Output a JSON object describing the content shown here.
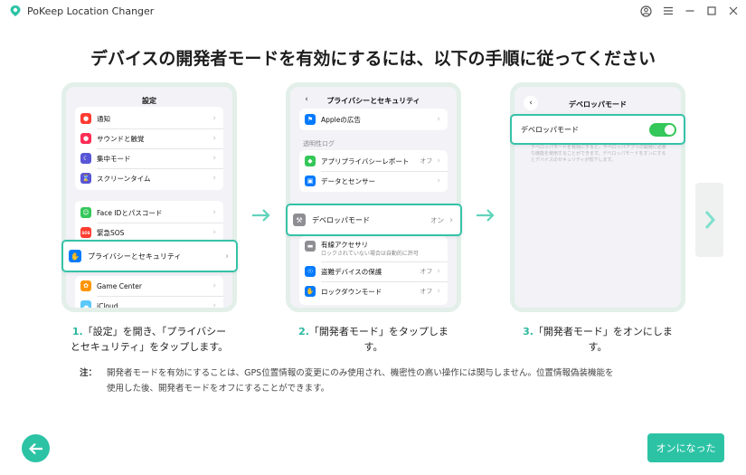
{
  "app": {
    "title": "PoKeep Location Changer"
  },
  "headline": "デバイスの開発者モードを有効にするには、以下の手順に従ってください",
  "phone1": {
    "title": "設定",
    "group1": [
      {
        "label": "通知",
        "color": "#ff3b30",
        "icon": "bell-icon"
      },
      {
        "label": "サウンドと触覚",
        "color": "#ff2d55",
        "icon": "speaker-icon"
      },
      {
        "label": "集中モード",
        "color": "#5856d6",
        "icon": "moon-icon"
      },
      {
        "label": "スクリーンタイム",
        "color": "#5856d6",
        "icon": "hourglass-icon"
      }
    ],
    "group2": [
      {
        "label": "Face IDとパスコード",
        "color": "#34c759",
        "icon": "face-id-icon"
      },
      {
        "label": "緊急SOS",
        "color": "#ff3b30",
        "icon": "sos-icon",
        "glyph": "SOS"
      }
    ],
    "highlight": {
      "label": "プライバシーとセキュリティ",
      "color": "#007aff",
      "icon": "hand-icon"
    },
    "group3": [
      {
        "label": "Game Center",
        "color": "#ff9500",
        "icon": "game-center-icon"
      },
      {
        "label": "iCloud",
        "color": "#5ac8fa",
        "icon": "cloud-icon"
      }
    ]
  },
  "phone2": {
    "title": "プライバシーとセキュリティ",
    "top_item": {
      "label": "Appleの広告",
      "color": "#007aff",
      "icon": "megaphone-icon"
    },
    "section_label": "透明性ログ",
    "group1": [
      {
        "label": "アプリプライバシーレポート",
        "value": "オフ",
        "color": "#34c759",
        "icon": "shield-icon"
      },
      {
        "label": "データとセンサー",
        "color": "#007aff",
        "icon": "cube-icon"
      }
    ],
    "highlight": {
      "label": "デベロッパモード",
      "value": "オン",
      "color": "#8e8e93",
      "icon": "hammer-icon"
    },
    "group2": [
      {
        "label": "有線アクセサリ",
        "sub": "ロックされていない場合は自動的に許可",
        "color": "#8e8e93",
        "icon": "cable-icon"
      },
      {
        "label": "盗難デバイスの保護",
        "value": "オフ",
        "color": "#007aff",
        "icon": "person-shield-icon"
      },
      {
        "label": "ロックダウンモード",
        "value": "オフ",
        "color": "#007aff",
        "icon": "lock-hand-icon"
      }
    ]
  },
  "phone3": {
    "title": "デベロッパモード",
    "toggle_label": "デベロッパモード",
    "toggle_on": true,
    "faded_text": "デベロッパモードを有効にすると、デベロッパアプリの開発に必要な機能を使用することができます。デベロッパモードをオンにするとデバイスのセキュリティが低下します。"
  },
  "steps": [
    {
      "num": "1.",
      "text_line1": "「設定」を開き、「プライバシー",
      "text_line2": "とセキュリティ」をタップします。"
    },
    {
      "num": "2.",
      "text_line1": "「開発者モード」をタップしま",
      "text_line2": "す。"
    },
    {
      "num": "3.",
      "text_line1": "「開発者モード」をオンにしま",
      "text_line2": "す。"
    }
  ],
  "note": {
    "label": "注：",
    "text": "開発者モードを有効にすることは、GPS位置情報の変更にのみ使用され、機密性の高い操作には関与しません。位置情報偽装機能を使用した後、開発者モードをオフにすることができます。"
  },
  "buttons": {
    "primary": "オンになった"
  },
  "colors": {
    "accent": "#2cc3a5",
    "highlight_border": "#35c2a8"
  }
}
